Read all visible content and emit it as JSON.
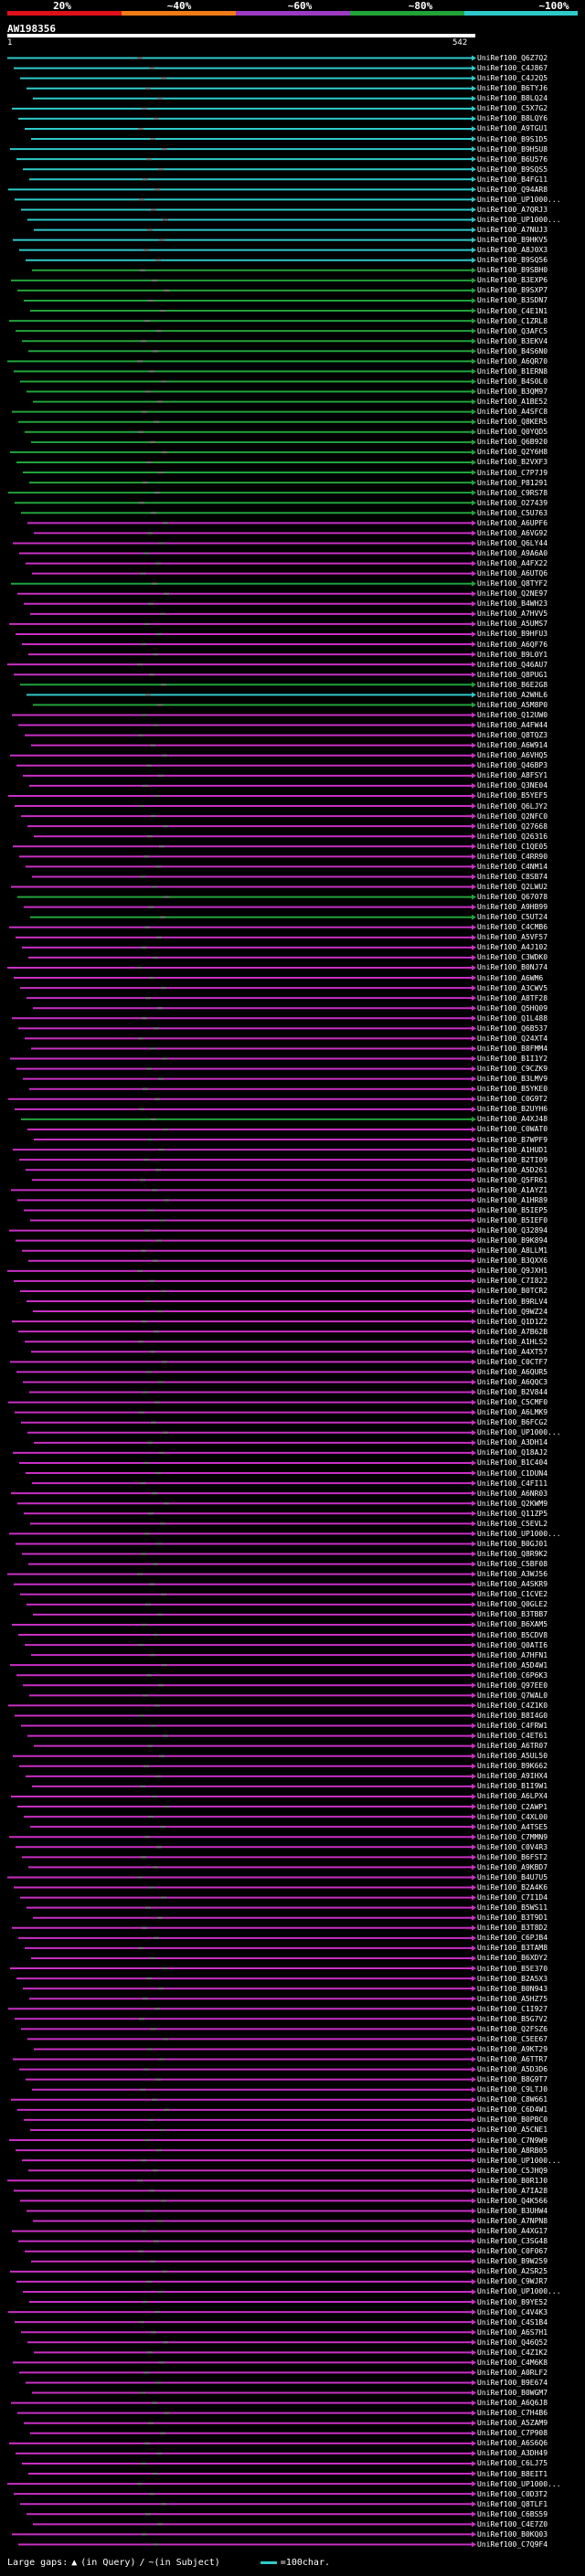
{
  "colors": {
    "background": "#000000",
    "legend": [
      "#e0101b",
      "#f07c16",
      "#9a3bc2",
      "#21a33a",
      "#2fc9c9"
    ],
    "cyan": "#2fc9c9",
    "green": "#21a33a",
    "magenta": "#c82fc3",
    "gray": "#777777",
    "query": "#ffffff"
  },
  "legend": {
    "ticks": [
      "20%",
      "~40%",
      "~60%",
      "~80%",
      "~100%"
    ]
  },
  "query": {
    "title": "AW198356",
    "start": "1",
    "end": "542"
  },
  "hits": [
    {
      "label": "UniRef100_Q6Z7Q2",
      "color": "cyan"
    },
    {
      "label": "UniRef100_C4J867",
      "color": "cyan"
    },
    {
      "label": "UniRef100_C4J2Q5",
      "color": "cyan"
    },
    {
      "label": "UniRef100_B6TYJ6",
      "color": "cyan"
    },
    {
      "label": "UniRef100_B8LQ24",
      "color": "cyan"
    },
    {
      "label": "UniRef100_C5X7G2",
      "color": "cyan"
    },
    {
      "label": "UniRef100_B8LQY6",
      "color": "cyan"
    },
    {
      "label": "UniRef100_A9TGU1",
      "color": "cyan"
    },
    {
      "label": "UniRef100_B9S1D5",
      "color": "cyan"
    },
    {
      "label": "UniRef100_B9H5U8",
      "color": "cyan"
    },
    {
      "label": "UniRef100_B6U576",
      "color": "cyan"
    },
    {
      "label": "UniRef100_B9SQS5",
      "color": "cyan"
    },
    {
      "label": "UniRef100_B4FG11",
      "color": "cyan"
    },
    {
      "label": "UniRef100_Q94AR8",
      "color": "cyan"
    },
    {
      "label": "UniRef100_UP1000...",
      "color": "cyan"
    },
    {
      "label": "UniRef100_A7QRJ3",
      "color": "cyan"
    },
    {
      "label": "UniRef100_UP1000...",
      "color": "cyan"
    },
    {
      "label": "UniRef100_A7NUJ3",
      "color": "cyan"
    },
    {
      "label": "UniRef100_B9HKV5",
      "color": "cyan"
    },
    {
      "label": "UniRef100_A8J0X3",
      "color": "cyan"
    },
    {
      "label": "UniRef100_B9SQ56",
      "color": "cyan"
    },
    {
      "label": "UniRef100_B9SBH0",
      "color": "green"
    },
    {
      "label": "UniRef100_B3EXP6",
      "color": "green"
    },
    {
      "label": "UniRef100_B9SXP7",
      "color": "green"
    },
    {
      "label": "UniRef100_B3SDN7",
      "color": "green"
    },
    {
      "label": "UniRef100_C4E1N1",
      "color": "green"
    },
    {
      "label": "UniRef100_C1ZRL8",
      "color": "green"
    },
    {
      "label": "UniRef100_Q3AFC5",
      "color": "green"
    },
    {
      "label": "UniRef100_B3EKV4",
      "color": "green"
    },
    {
      "label": "UniRef100_B4S6N0",
      "color": "green"
    },
    {
      "label": "UniRef100_A6QR70",
      "color": "green"
    },
    {
      "label": "UniRef100_B1ERN8",
      "color": "green"
    },
    {
      "label": "UniRef100_B4S0L0",
      "color": "green"
    },
    {
      "label": "UniRef100_B3QM97",
      "color": "green"
    },
    {
      "label": "UniRef100_A1BE52",
      "color": "green"
    },
    {
      "label": "UniRef100_A4SFC8",
      "color": "green"
    },
    {
      "label": "UniRef100_Q8KER5",
      "color": "green"
    },
    {
      "label": "UniRef100_Q0YQD5",
      "color": "green"
    },
    {
      "label": "UniRef100_Q6B920",
      "color": "green"
    },
    {
      "label": "UniRef100_Q2Y6H8",
      "color": "green"
    },
    {
      "label": "UniRef100_B2VXF3",
      "color": "green"
    },
    {
      "label": "UniRef100_C7P7J9",
      "color": "green"
    },
    {
      "label": "UniRef100_P81291",
      "color": "green"
    },
    {
      "label": "UniRef100_C9RS78",
      "color": "green"
    },
    {
      "label": "UniRef100_O27439",
      "color": "green"
    },
    {
      "label": "UniRef100_C5U763",
      "color": "green"
    },
    {
      "label": "UniRef100_A6UPF6",
      "color": "magenta"
    },
    {
      "label": "UniRef100_A6VG92",
      "color": "magenta"
    },
    {
      "label": "UniRef100_Q6LY44",
      "color": "magenta"
    },
    {
      "label": "UniRef100_A9A6A0",
      "color": "magenta"
    },
    {
      "label": "UniRef100_A4FX22",
      "color": "magenta"
    },
    {
      "label": "UniRef100_A6UTQ6",
      "color": "magenta"
    },
    {
      "label": "UniRef100_Q8TYF2",
      "color": "green"
    },
    {
      "label": "UniRef100_Q2NE97",
      "color": "magenta"
    },
    {
      "label": "UniRef100_B4WH23",
      "color": "magenta"
    },
    {
      "label": "UniRef100_A7HVV5",
      "color": "magenta"
    },
    {
      "label": "UniRef100_A5UMS7",
      "color": "magenta"
    },
    {
      "label": "UniRef100_B9HFU3",
      "color": "magenta"
    },
    {
      "label": "UniRef100_A6QF76",
      "color": "magenta"
    },
    {
      "label": "UniRef100_B9L0Y1",
      "color": "magenta"
    },
    {
      "label": "UniRef100_Q46AU7",
      "color": "magenta"
    },
    {
      "label": "UniRef100_Q8PUG1",
      "color": "magenta"
    },
    {
      "label": "UniRef100_B6E2G8",
      "color": "green"
    },
    {
      "label": "UniRef100_A2WHL6",
      "color": "cyan"
    },
    {
      "label": "UniRef100_A5M8P0",
      "color": "green"
    },
    {
      "label": "UniRef100_Q12UW0",
      "color": "magenta"
    },
    {
      "label": "UniRef100_A4FW44",
      "color": "magenta"
    },
    {
      "label": "UniRef100_Q8TQZ3",
      "color": "magenta"
    },
    {
      "label": "UniRef100_A6W914",
      "color": "magenta"
    },
    {
      "label": "UniRef100_A6VHQ5",
      "color": "magenta"
    },
    {
      "label": "UniRef100_Q46BP3",
      "color": "magenta"
    },
    {
      "label": "UniRef100_A8FSY1",
      "color": "magenta"
    },
    {
      "label": "UniRef100_Q3NE04",
      "color": "magenta"
    },
    {
      "label": "UniRef100_B5YEF5",
      "color": "magenta"
    },
    {
      "label": "UniRef100_Q6LJY2",
      "color": "magenta"
    },
    {
      "label": "UniRef100_Q2NFC0",
      "color": "magenta"
    },
    {
      "label": "UniRef100_Q27668",
      "color": "magenta"
    },
    {
      "label": "UniRef100_Q26316",
      "color": "magenta"
    },
    {
      "label": "UniRef100_C1QE05",
      "color": "magenta"
    },
    {
      "label": "UniRef100_C4RR90",
      "color": "magenta"
    },
    {
      "label": "UniRef100_C4NM14",
      "color": "magenta"
    },
    {
      "label": "UniRef100_C8SB74",
      "color": "magenta"
    },
    {
      "label": "UniRef100_Q2LWU2",
      "color": "magenta"
    },
    {
      "label": "UniRef100_Q67078",
      "color": "green"
    },
    {
      "label": "UniRef100_A9HB99",
      "color": "magenta"
    },
    {
      "label": "UniRef100_C5UT24",
      "color": "green"
    },
    {
      "label": "UniRef100_C4CMB6",
      "color": "magenta"
    },
    {
      "label": "UniRef100_A5VF57",
      "color": "magenta"
    },
    {
      "label": "UniRef100_A4J102",
      "color": "magenta"
    },
    {
      "label": "UniRef100_C3WDK0",
      "color": "magenta"
    },
    {
      "label": "UniRef100_B0NJ74",
      "color": "magenta"
    },
    {
      "label": "UniRef100_A6WM6",
      "color": "magenta"
    },
    {
      "label": "UniRef100_A3CWV5",
      "color": "magenta"
    },
    {
      "label": "UniRef100_A8TF28",
      "color": "magenta"
    },
    {
      "label": "UniRef100_Q5HQ09",
      "color": "magenta"
    },
    {
      "label": "UniRef100_Q1L488",
      "color": "magenta"
    },
    {
      "label": "UniRef100_Q6B537",
      "color": "magenta"
    },
    {
      "label": "UniRef100_Q24XT4",
      "color": "magenta"
    },
    {
      "label": "UniRef100_B8FMM4",
      "color": "magenta"
    },
    {
      "label": "UniRef100_B1I1Y2",
      "color": "magenta"
    },
    {
      "label": "UniRef100_C9CZK9",
      "color": "magenta"
    },
    {
      "label": "UniRef100_B3LMV9",
      "color": "magenta"
    },
    {
      "label": "UniRef100_B5YKE0",
      "color": "magenta"
    },
    {
      "label": "UniRef100_C0G9T2",
      "color": "magenta"
    },
    {
      "label": "UniRef100_B2UYH6",
      "color": "magenta"
    },
    {
      "label": "UniRef100_A4XJ48",
      "color": "green"
    },
    {
      "label": "UniRef100_C0WAT0",
      "color": "magenta"
    },
    {
      "label": "UniRef100_B7WPF9",
      "color": "magenta"
    },
    {
      "label": "UniRef100_A1HUD1",
      "color": "magenta"
    },
    {
      "label": "UniRef100_B2TI09",
      "color": "magenta"
    },
    {
      "label": "UniRef100_A5D261",
      "color": "magenta"
    },
    {
      "label": "UniRef100_Q5FR61",
      "color": "magenta"
    },
    {
      "label": "UniRef100_A1AYZ1",
      "color": "magenta"
    },
    {
      "label": "UniRef100_A1HR89",
      "color": "magenta"
    },
    {
      "label": "UniRef100_B5IEP5",
      "color": "magenta"
    },
    {
      "label": "UniRef100_B5IEF0",
      "color": "magenta"
    },
    {
      "label": "UniRef100_Q32894",
      "color": "magenta"
    },
    {
      "label": "UniRef100_B9K894",
      "color": "magenta"
    },
    {
      "label": "UniRef100_A8LLM1",
      "color": "magenta"
    },
    {
      "label": "UniRef100_B3QXX6",
      "color": "magenta"
    },
    {
      "label": "UniRef100_Q9JXH1",
      "color": "magenta"
    },
    {
      "label": "UniRef100_C7I822",
      "color": "magenta"
    },
    {
      "label": "UniRef100_B0TCR2",
      "color": "magenta"
    },
    {
      "label": "UniRef100_B9RLV4",
      "color": "magenta"
    },
    {
      "label": "UniRef100_Q9WZ24",
      "color": "magenta"
    },
    {
      "label": "UniRef100_Q1D1Z2",
      "color": "magenta"
    },
    {
      "label": "UniRef100_A7B62B",
      "color": "magenta"
    },
    {
      "label": "UniRef100_A1HLS2",
      "color": "magenta"
    },
    {
      "label": "UniRef100_A4XT57",
      "color": "magenta"
    },
    {
      "label": "UniRef100_C0CTF7",
      "color": "magenta"
    },
    {
      "label": "UniRef100_A6QUR5",
      "color": "magenta"
    },
    {
      "label": "UniRef100_A6QQC3",
      "color": "magenta"
    },
    {
      "label": "UniRef100_B2V844",
      "color": "magenta"
    },
    {
      "label": "UniRef100_C5CMF0",
      "color": "magenta"
    },
    {
      "label": "UniRef100_A6LMK9",
      "color": "magenta"
    },
    {
      "label": "UniRef100_B6FCG2",
      "color": "magenta"
    },
    {
      "label": "UniRef100_UP1000...",
      "color": "magenta"
    },
    {
      "label": "UniRef100_A3DH14",
      "color": "magenta"
    },
    {
      "label": "UniRef100_Q18AJ2",
      "color": "magenta"
    },
    {
      "label": "UniRef100_B1C404",
      "color": "magenta"
    },
    {
      "label": "UniRef100_C1DUN4",
      "color": "magenta"
    },
    {
      "label": "UniRef100_C4FI11",
      "color": "magenta"
    },
    {
      "label": "UniRef100_A6NR03",
      "color": "magenta"
    },
    {
      "label": "UniRef100_Q2KWM9",
      "color": "magenta"
    },
    {
      "label": "UniRef100_Q11ZP5",
      "color": "magenta"
    },
    {
      "label": "UniRef100_C5EVL2",
      "color": "magenta"
    },
    {
      "label": "UniRef100_UP1000...",
      "color": "magenta"
    },
    {
      "label": "UniRef100_B0GJ01",
      "color": "magenta"
    },
    {
      "label": "UniRef100_Q8R9K2",
      "color": "magenta"
    },
    {
      "label": "UniRef100_C5BF08",
      "color": "magenta"
    },
    {
      "label": "UniRef100_A3WJ56",
      "color": "magenta"
    },
    {
      "label": "UniRef100_A4SKR9",
      "color": "magenta"
    },
    {
      "label": "UniRef100_C1CVE2",
      "color": "magenta"
    },
    {
      "label": "UniRef100_Q0GLE2",
      "color": "magenta"
    },
    {
      "label": "UniRef100_B3TBB7",
      "color": "magenta"
    },
    {
      "label": "UniRef100_B6XAM5",
      "color": "magenta"
    },
    {
      "label": "UniRef100_B5CDV8",
      "color": "magenta"
    },
    {
      "label": "UniRef100_Q0ATI6",
      "color": "magenta"
    },
    {
      "label": "UniRef100_A7HFN1",
      "color": "magenta"
    },
    {
      "label": "UniRef100_A5D4W1",
      "color": "magenta"
    },
    {
      "label": "UniRef100_C6P6K3",
      "color": "magenta"
    },
    {
      "label": "UniRef100_Q97EE0",
      "color": "magenta"
    },
    {
      "label": "UniRef100_Q7WAL0",
      "color": "magenta"
    },
    {
      "label": "UniRef100_C4Z1K0",
      "color": "magenta"
    },
    {
      "label": "UniRef100_B8I4G0",
      "color": "magenta"
    },
    {
      "label": "UniRef100_C4FRW1",
      "color": "magenta"
    },
    {
      "label": "UniRef100_C4ET61",
      "color": "magenta"
    },
    {
      "label": "UniRef100_A6TR07",
      "color": "magenta"
    },
    {
      "label": "UniRef100_A5UL50",
      "color": "magenta"
    },
    {
      "label": "UniRef100_B9K662",
      "color": "magenta"
    },
    {
      "label": "UniRef100_A9IHX4",
      "color": "magenta"
    },
    {
      "label": "UniRef100_B1I9W1",
      "color": "magenta"
    },
    {
      "label": "UniRef100_A6LPX4",
      "color": "magenta"
    },
    {
      "label": "UniRef100_C2AWP1",
      "color": "magenta"
    },
    {
      "label": "UniRef100_C4XL00",
      "color": "magenta"
    },
    {
      "label": "UniRef100_A4TSE5",
      "color": "magenta"
    },
    {
      "label": "UniRef100_C7MMN9",
      "color": "magenta"
    },
    {
      "label": "UniRef100_C0V4R3",
      "color": "magenta"
    },
    {
      "label": "UniRef100_B6FST2",
      "color": "magenta"
    },
    {
      "label": "UniRef100_A9KBD7",
      "color": "magenta"
    },
    {
      "label": "UniRef100_B4U7U5",
      "color": "magenta"
    },
    {
      "label": "UniRef100_B2A4K6",
      "color": "magenta"
    },
    {
      "label": "UniRef100_C7I1D4",
      "color": "magenta"
    },
    {
      "label": "UniRef100_B5WS11",
      "color": "magenta"
    },
    {
      "label": "UniRef100_B3T9D1",
      "color": "magenta"
    },
    {
      "label": "UniRef100_B3T8D2",
      "color": "magenta"
    },
    {
      "label": "UniRef100_C6PJB4",
      "color": "magenta"
    },
    {
      "label": "UniRef100_B3TAM8",
      "color": "magenta"
    },
    {
      "label": "UniRef100_B6XDY2",
      "color": "magenta"
    },
    {
      "label": "UniRef100_B5E370",
      "color": "magenta"
    },
    {
      "label": "UniRef100_B2A5X3",
      "color": "magenta"
    },
    {
      "label": "UniRef100_B0N943",
      "color": "magenta"
    },
    {
      "label": "UniRef100_A5HZ75",
      "color": "magenta"
    },
    {
      "label": "UniRef100_C1I927",
      "color": "magenta"
    },
    {
      "label": "UniRef100_B5G7V2",
      "color": "magenta"
    },
    {
      "label": "UniRef100_Q2FSZ6",
      "color": "magenta"
    },
    {
      "label": "UniRef100_C5EE67",
      "color": "magenta"
    },
    {
      "label": "UniRef100_A9KT29",
      "color": "magenta"
    },
    {
      "label": "UniRef100_A6TTR7",
      "color": "magenta"
    },
    {
      "label": "UniRef100_A5D3D6",
      "color": "magenta"
    },
    {
      "label": "UniRef100_B8G9T7",
      "color": "magenta"
    },
    {
      "label": "UniRef100_C9LTJ0",
      "color": "magenta"
    },
    {
      "label": "UniRef100_C8W661",
      "color": "magenta"
    },
    {
      "label": "UniRef100_C6D4W1",
      "color": "magenta"
    },
    {
      "label": "UniRef100_B0PBC0",
      "color": "magenta"
    },
    {
      "label": "UniRef100_A5CNE1",
      "color": "magenta"
    },
    {
      "label": "UniRef100_C7N9W9",
      "color": "magenta"
    },
    {
      "label": "UniRef100_A8RB05",
      "color": "magenta"
    },
    {
      "label": "UniRef100_UP1000...",
      "color": "magenta"
    },
    {
      "label": "UniRef100_C5JHQ9",
      "color": "magenta"
    },
    {
      "label": "UniRef100_B0R1J0",
      "color": "magenta"
    },
    {
      "label": "UniRef100_A7IA28",
      "color": "magenta"
    },
    {
      "label": "UniRef100_Q4K566",
      "color": "magenta"
    },
    {
      "label": "UniRef100_B3UHW4",
      "color": "magenta"
    },
    {
      "label": "UniRef100_A7NPN8",
      "color": "magenta"
    },
    {
      "label": "UniRef100_A4XG17",
      "color": "magenta"
    },
    {
      "label": "UniRef100_C3SG48",
      "color": "magenta"
    },
    {
      "label": "UniRef100_C0F067",
      "color": "magenta"
    },
    {
      "label": "UniRef100_B9W259",
      "color": "magenta"
    },
    {
      "label": "UniRef100_A2SR25",
      "color": "magenta"
    },
    {
      "label": "UniRef100_C9WJR7",
      "color": "magenta"
    },
    {
      "label": "UniRef100_UP1000...",
      "color": "magenta"
    },
    {
      "label": "UniRef100_B9YE52",
      "color": "magenta"
    },
    {
      "label": "UniRef100_C4V4K3",
      "color": "magenta"
    },
    {
      "label": "UniRef100_C4S1B4",
      "color": "magenta"
    },
    {
      "label": "UniRef100_A6S7H1",
      "color": "magenta"
    },
    {
      "label": "UniRef100_Q46Q52",
      "color": "magenta"
    },
    {
      "label": "UniRef100_C4Z1K2",
      "color": "magenta"
    },
    {
      "label": "UniRef100_C4M6K8",
      "color": "magenta"
    },
    {
      "label": "UniRef100_A0RLF2",
      "color": "magenta"
    },
    {
      "label": "UniRef100_B9E674",
      "color": "magenta"
    },
    {
      "label": "UniRef100_B0WGM7",
      "color": "magenta"
    },
    {
      "label": "UniRef100_A6Q6J8",
      "color": "magenta"
    },
    {
      "label": "UniRef100_C7H4B6",
      "color": "magenta"
    },
    {
      "label": "UniRef100_A5ZAM9",
      "color": "magenta"
    },
    {
      "label": "UniRef100_C7P908",
      "color": "magenta"
    },
    {
      "label": "UniRef100_A6S6Q6",
      "color": "magenta"
    },
    {
      "label": "UniRef100_A3DH49",
      "color": "magenta"
    },
    {
      "label": "UniRef100_C6LJ75",
      "color": "magenta"
    },
    {
      "label": "UniRef100_B8EIT1",
      "color": "magenta"
    },
    {
      "label": "UniRef100_UP1000...",
      "color": "magenta"
    },
    {
      "label": "UniRef100_C0D3T2",
      "color": "magenta"
    },
    {
      "label": "UniRef100_Q8TLF1",
      "color": "magenta"
    },
    {
      "label": "UniRef100_C6BS59",
      "color": "magenta"
    },
    {
      "label": "UniRef100_C4E7Z0",
      "color": "magenta"
    },
    {
      "label": "UniRef100_B0KQ03",
      "color": "magenta"
    },
    {
      "label": "UniRef100_C7Q9F4",
      "color": "magenta"
    }
  ],
  "footer": {
    "large_gaps": "Large gaps:",
    "in_query": "(in Query)",
    "slash": "/",
    "in_subject": "~(in Subject)",
    "scale": "=100char."
  }
}
